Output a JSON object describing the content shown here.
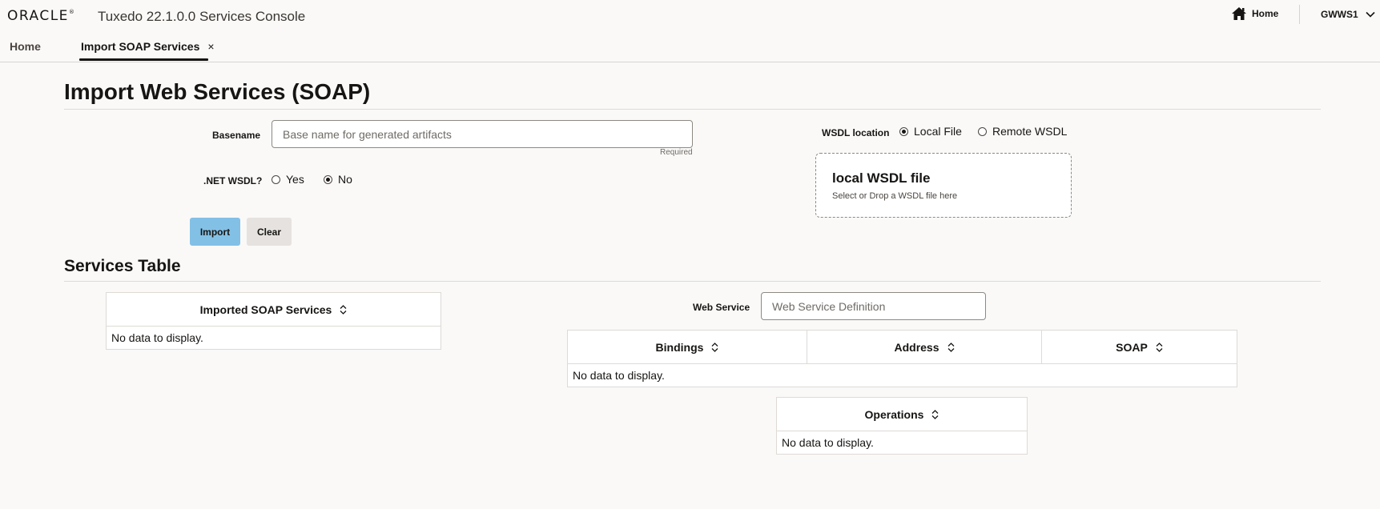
{
  "header": {
    "logo_text": "ORACLE",
    "logo_reg": "®",
    "app_title": "Tuxedo 22.1.0.0 Services Console",
    "home_label": "Home",
    "user_label": "GWWS1"
  },
  "tabs": {
    "home": "Home",
    "active": "Import SOAP Services",
    "close_glyph": "×"
  },
  "page": {
    "title": "Import Web Services (SOAP)",
    "form": {
      "basename_label": "Basename",
      "basename_placeholder": "Base name for generated artifacts",
      "basename_value": "",
      "required_text": "Required",
      "net_wsdl_label": ".NET WSDL?",
      "net_wsdl_options": [
        {
          "label": "Yes",
          "selected": false
        },
        {
          "label": "No",
          "selected": true
        }
      ],
      "wsdl_location_label": "WSDL location",
      "wsdl_location_options": [
        {
          "label": "Local File",
          "selected": true
        },
        {
          "label": "Remote WSDL",
          "selected": false
        }
      ],
      "dropzone_title": "local WSDL file",
      "dropzone_subtitle": "Select or Drop a WSDL file here",
      "import_button": "Import",
      "clear_button": "Clear"
    }
  },
  "services": {
    "title": "Services Table",
    "imported_table": {
      "header": "Imported SOAP Services",
      "empty_text": "No data to display."
    },
    "web_service_label": "Web Service",
    "web_service_placeholder": "Web Service Definition",
    "bindings_table": {
      "columns": [
        "Bindings",
        "Address",
        "SOAP"
      ],
      "empty_text": "No data to display."
    },
    "operations_table": {
      "header": "Operations",
      "empty_text": "No data to display."
    }
  },
  "colors": {
    "background": "#faf9f8",
    "primary_button": "#83c0e6",
    "secondary_button": "#e5e2df",
    "text": "#161513"
  }
}
